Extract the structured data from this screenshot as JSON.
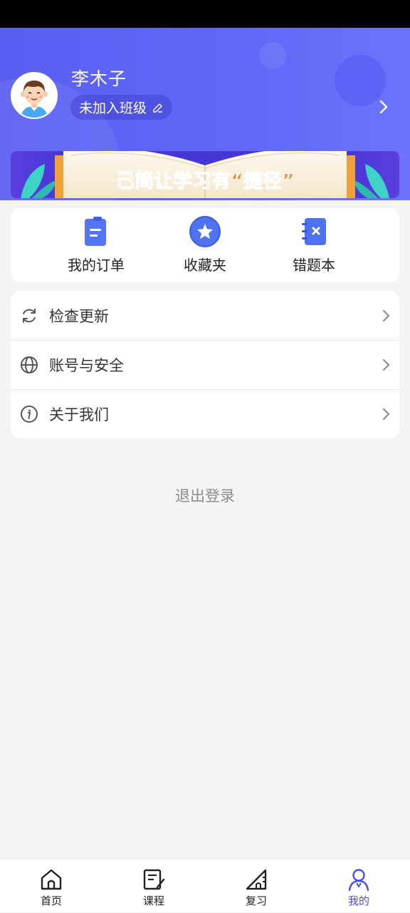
{
  "profile": {
    "name": "李木子",
    "class_status": "未加入班级",
    "avatar_icon": "boy-avatar-icon",
    "edit_icon": "edit-icon",
    "chevron_icon": "chevron-right-icon"
  },
  "banner": {
    "text": "己简让学习有“捷径”"
  },
  "shortcuts": [
    {
      "label": "我的订单",
      "icon": "order-icon"
    },
    {
      "label": "收藏夹",
      "icon": "star-icon"
    },
    {
      "label": "错题本",
      "icon": "wrong-notebook-icon"
    }
  ],
  "menu": [
    {
      "label": "检查更新",
      "icon": "refresh-icon"
    },
    {
      "label": "账号与安全",
      "icon": "globe-icon"
    },
    {
      "label": "关于我们",
      "icon": "info-icon"
    }
  ],
  "logout_label": "退出登录",
  "tabs": [
    {
      "label": "首页",
      "icon": "home-icon",
      "active": false
    },
    {
      "label": "课程",
      "icon": "course-icon",
      "active": false
    },
    {
      "label": "复习",
      "icon": "review-icon",
      "active": false
    },
    {
      "label": "我的",
      "icon": "user-icon",
      "active": true
    }
  ],
  "colors": {
    "accent": "#4a4ee6",
    "header_gradient_start": "#5a5ef2",
    "header_gradient_end": "#6c74fb",
    "background": "#f4f4f4"
  }
}
